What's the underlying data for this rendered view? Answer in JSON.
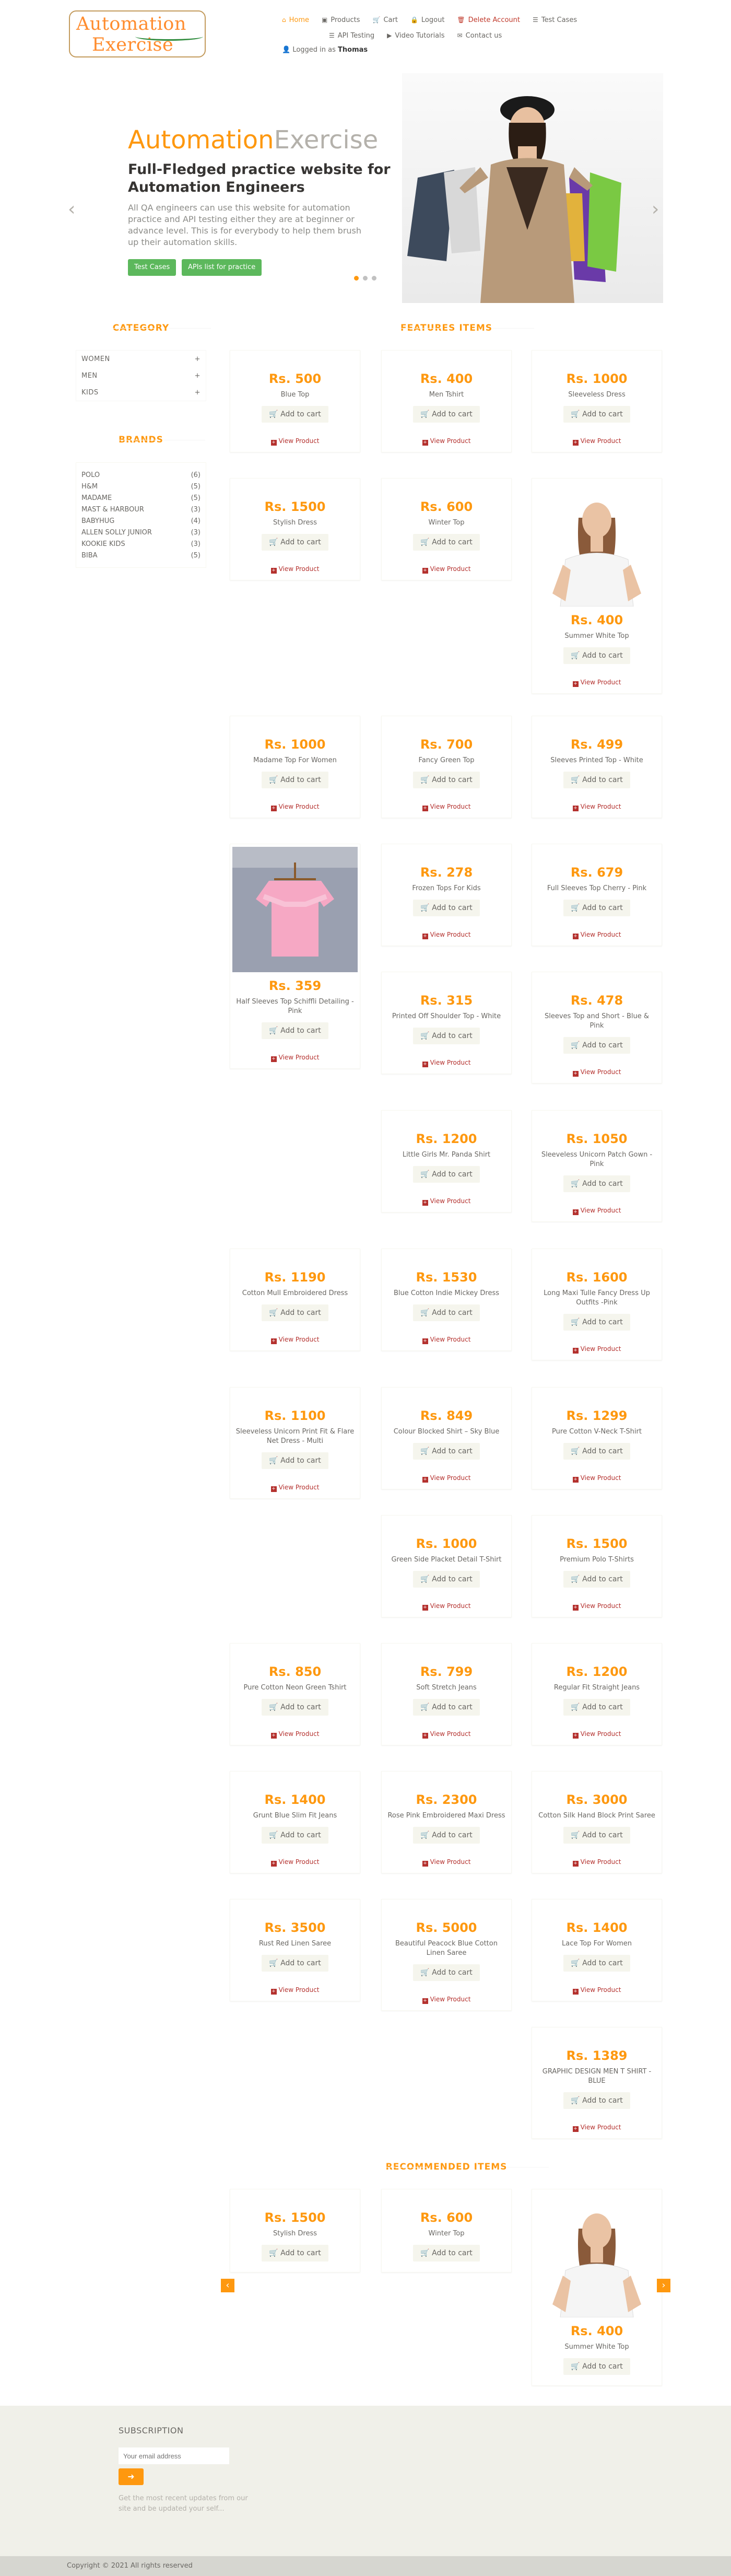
{
  "header": {
    "logo_line1": "Automation",
    "logo_line2": "Exercise",
    "nav": [
      {
        "label": "Home",
        "icon": "home-icon"
      },
      {
        "label": "Products",
        "icon": "shirt-icon"
      },
      {
        "label": "Cart",
        "icon": "cart-icon"
      },
      {
        "label": "Logout",
        "icon": "lock-icon"
      },
      {
        "label": "Delete Account",
        "icon": "trash-icon"
      },
      {
        "label": "Test Cases",
        "icon": "list-icon"
      },
      {
        "label": "API Testing",
        "icon": "list-icon"
      },
      {
        "label": "Video Tutorials",
        "icon": "youtube-icon"
      },
      {
        "label": "Contact us",
        "icon": "envelope-icon"
      }
    ],
    "logged_in_prefix": "Logged in as",
    "logged_in_user": "Thomas"
  },
  "slider": {
    "title_orange": "Automation",
    "title_gray": "Exercise",
    "subtitle": "Full-Fledged practice website for Automation Engineers",
    "description": "All QA engineers can use this website for automation practice and API testing either they are at beginner or advance level. This is for everybody to help them brush up their automation skills.",
    "btn_test_cases": "Test Cases",
    "btn_apis": "APIs list for practice"
  },
  "sidebar": {
    "category_title": "CATEGORY",
    "categories": [
      "WOMEN",
      "MEN",
      "KIDS"
    ],
    "brands_title": "BRANDS",
    "brands": [
      {
        "name": "POLO",
        "count": "(6)"
      },
      {
        "name": "H&M",
        "count": "(5)"
      },
      {
        "name": "MADAME",
        "count": "(5)"
      },
      {
        "name": "MAST & HARBOUR",
        "count": "(3)"
      },
      {
        "name": "BABYHUG",
        "count": "(4)"
      },
      {
        "name": "ALLEN SOLLY JUNIOR",
        "count": "(3)"
      },
      {
        "name": "KOOKIE KIDS",
        "count": "(3)"
      },
      {
        "name": "BIBA",
        "count": "(5)"
      }
    ]
  },
  "features_title": "FEATURES ITEMS",
  "add_to_cart": "Add to cart",
  "view_product": "View Product",
  "products": [
    {
      "price": "Rs. 500",
      "name": "Blue Top"
    },
    {
      "price": "Rs. 400",
      "name": "Men Tshirt"
    },
    {
      "price": "Rs. 1000",
      "name": "Sleeveless Dress"
    },
    {
      "price": "Rs. 1500",
      "name": "Stylish Dress"
    },
    {
      "price": "Rs. 600",
      "name": "Winter Top"
    },
    {
      "price": "Rs. 400",
      "name": "Summer White Top"
    },
    {
      "price": "Rs. 1000",
      "name": "Madame Top For Women"
    },
    {
      "price": "Rs. 700",
      "name": "Fancy Green Top"
    },
    {
      "price": "Rs. 499",
      "name": "Sleeves Printed Top - White"
    },
    {
      "price": "Rs. 359",
      "name": "Half Sleeves Top Schiffli Detailing - Pink"
    },
    {
      "price": "Rs. 278",
      "name": "Frozen Tops For Kids"
    },
    {
      "price": "Rs. 679",
      "name": "Full Sleeves Top Cherry - Pink"
    },
    {
      "price": "Rs. 315",
      "name": "Printed Off Shoulder Top - White"
    },
    {
      "price": "Rs. 478",
      "name": "Sleeves Top and Short - Blue & Pink"
    },
    {
      "price": "Rs. 1200",
      "name": "Little Girls Mr. Panda Shirt"
    },
    {
      "price": "Rs. 1050",
      "name": "Sleeveless Unicorn Patch Gown - Pink"
    },
    {
      "price": "Rs. 1190",
      "name": "Cotton Mull Embroidered Dress"
    },
    {
      "price": "Rs. 1530",
      "name": "Blue Cotton Indie Mickey Dress"
    },
    {
      "price": "Rs. 1600",
      "name": "Long Maxi Tulle Fancy Dress Up Outfits -Pink"
    },
    {
      "price": "Rs. 1100",
      "name": "Sleeveless Unicorn Print Fit & Flare Net Dress - Multi"
    },
    {
      "price": "Rs. 849",
      "name": "Colour Blocked Shirt – Sky Blue"
    },
    {
      "price": "Rs. 1299",
      "name": "Pure Cotton V-Neck T-Shirt"
    },
    {
      "price": "Rs. 1000",
      "name": "Green Side Placket Detail T-Shirt"
    },
    {
      "price": "Rs. 1500",
      "name": "Premium Polo T-Shirts"
    },
    {
      "price": "Rs. 850",
      "name": "Pure Cotton Neon Green Tshirt"
    },
    {
      "price": "Rs. 799",
      "name": "Soft Stretch Jeans"
    },
    {
      "price": "Rs. 1200",
      "name": "Regular Fit Straight Jeans"
    },
    {
      "price": "Rs. 1400",
      "name": "Grunt Blue Slim Fit Jeans"
    },
    {
      "price": "Rs. 2300",
      "name": "Rose Pink Embroidered Maxi Dress"
    },
    {
      "price": "Rs. 3000",
      "name": "Cotton Silk Hand Block Print Saree"
    },
    {
      "price": "Rs. 3500",
      "name": "Rust Red Linen Saree"
    },
    {
      "price": "Rs. 5000",
      "name": "Beautiful Peacock Blue Cotton Linen Saree"
    },
    {
      "price": "Rs. 1400",
      "name": "Lace Top For Women"
    },
    {
      "price": "Rs. 1389",
      "name": "GRAPHIC DESIGN MEN T SHIRT - BLUE"
    }
  ],
  "recommended": {
    "title": "RECOMMENDED ITEMS",
    "items": [
      {
        "price": "Rs. 1500",
        "name": "Stylish Dress"
      },
      {
        "price": "Rs. 600",
        "name": "Winter Top"
      },
      {
        "price": "Rs. 400",
        "name": "Summer White Top"
      }
    ]
  },
  "footer": {
    "subscription_title": "SUBSCRIPTION",
    "email_placeholder": "Your email address",
    "note": "Get the most recent updates from our site and be updated your self...",
    "copyright": "Copyright © 2021 All rights reserved"
  },
  "colors": {
    "accent": "#FE980F",
    "button_green": "#5CB85C",
    "link_red": "#B4312E"
  }
}
